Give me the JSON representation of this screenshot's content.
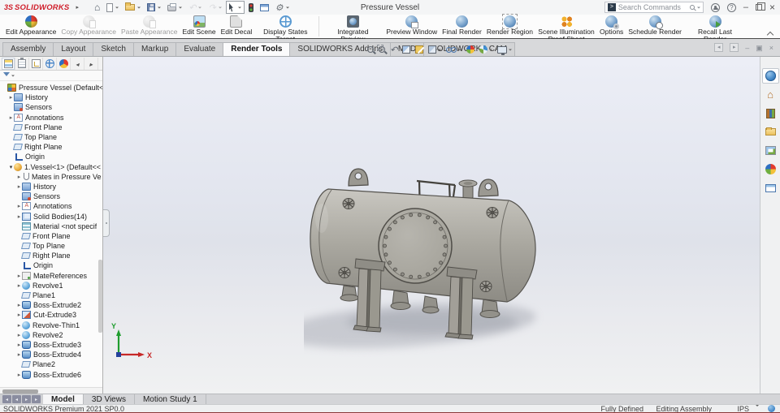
{
  "titlebar": {
    "logo_mark": "3S",
    "logo": "SOLIDWORKS",
    "title": "Pressure Vessel",
    "search_placeholder": "Search Commands"
  },
  "quick_toolbar": [
    {
      "name": "home-icon",
      "variant": "home",
      "caret": false
    },
    {
      "name": "new-document-icon",
      "variant": "new",
      "caret": true
    },
    {
      "name": "open-icon",
      "variant": "open",
      "caret": true
    },
    {
      "name": "save-icon",
      "variant": "save",
      "caret": true
    },
    {
      "name": "print-icon",
      "variant": "print",
      "caret": true
    },
    {
      "name": "undo-icon",
      "variant": "undo",
      "caret": true,
      "disabled": true
    },
    {
      "name": "redo-icon",
      "variant": "redo",
      "caret": true,
      "disabled": true
    },
    {
      "name": "select-cursor-icon",
      "variant": "select",
      "caret": true,
      "boxed": true
    },
    {
      "name": "traffic-light-icon",
      "variant": "traffic",
      "caret": false
    },
    {
      "name": "task-table-icon",
      "variant": "table",
      "caret": false
    },
    {
      "name": "settings-gear-icon",
      "variant": "gear",
      "caret": true
    }
  ],
  "ribbon": {
    "group1": [
      {
        "name": "edit-appearance-button",
        "label": "Edit Appearance",
        "variant": "edit-appearance"
      },
      {
        "name": "copy-appearance-button",
        "label": "Copy Appearance",
        "variant": "copy-appearance",
        "disabled": true
      },
      {
        "name": "paste-appearance-button",
        "label": "Paste Appearance",
        "variant": "paste-appearance",
        "disabled": true
      },
      {
        "name": "edit-scene-button",
        "label": "Edit Scene",
        "variant": "edit-scene"
      },
      {
        "name": "edit-decal-button",
        "label": "Edit Decal",
        "variant": "edit-decal"
      },
      {
        "name": "display-states-target-button",
        "label": "Display States Target",
        "variant": "display-states"
      }
    ],
    "group2": [
      {
        "name": "integrated-preview-button",
        "label": "Integrated Preview",
        "variant": "int-preview"
      },
      {
        "name": "preview-window-button",
        "label": "Preview Window",
        "variant": "prev-window"
      },
      {
        "name": "final-render-button",
        "label": "Final Render",
        "variant": "final-render"
      },
      {
        "name": "render-region-button",
        "label": "Render Region",
        "variant": "render-region"
      },
      {
        "name": "scene-illumination-proof-sheet-button",
        "label": "Scene Illumination Proof Sheet",
        "variant": "proof-sheet"
      },
      {
        "name": "options-button",
        "label": "Options",
        "variant": "options"
      },
      {
        "name": "schedule-render-button",
        "label": "Schedule Render",
        "variant": "schedule"
      },
      {
        "name": "recall-last-render-button",
        "label": "Recall Last Render",
        "variant": "recall"
      }
    ]
  },
  "command_tabs": [
    {
      "label": "Assembly"
    },
    {
      "label": "Layout"
    },
    {
      "label": "Sketch"
    },
    {
      "label": "Markup"
    },
    {
      "label": "Evaluate"
    },
    {
      "label": "Render Tools",
      "active": true
    },
    {
      "label": "SOLIDWORKS Add-Ins"
    },
    {
      "label": "MBD"
    },
    {
      "label": "SOLIDWORKS CAM"
    }
  ],
  "heads_up": [
    {
      "name": "zoom-to-fit-icon",
      "variant": "zoomfit",
      "caret": false
    },
    {
      "name": "zoom-to-area-icon",
      "variant": "zoomarea",
      "caret": false
    },
    {
      "name": "previous-view-icon",
      "variant": "prevview",
      "caret": false
    },
    {
      "name": "section-view-icon",
      "variant": "section",
      "caret": false
    },
    {
      "name": "dynamic-annotation-icon",
      "variant": "annotate",
      "caret": false
    },
    {
      "name": "display-style-icon",
      "variant": "dispstyle",
      "caret": true
    },
    {
      "name": "hide-show-items-icon",
      "variant": "hideshow",
      "caret": true
    },
    {
      "name": "edit-appearance-icon",
      "variant": "appearance",
      "caret": false
    },
    {
      "name": "apply-scene-icon",
      "variant": "scene",
      "caret": true
    },
    {
      "name": "view-settings-icon",
      "variant": "viewset",
      "caret": true
    }
  ],
  "doc_window_controls": [
    {
      "name": "doc-prev-icon",
      "glyph": "◂",
      "boxed": true
    },
    {
      "name": "doc-next-icon",
      "glyph": "▸",
      "boxed": true
    },
    {
      "name": "doc-minimize-icon",
      "glyph": "–",
      "boxed": false
    },
    {
      "name": "doc-restore-icon",
      "glyph": "▣",
      "boxed": false
    },
    {
      "name": "doc-close-icon",
      "glyph": "×",
      "boxed": false
    }
  ],
  "panel_tabs": [
    {
      "name": "featuremanager-tab",
      "variant": "featman",
      "active": true
    },
    {
      "name": "propertymanager-tab",
      "variant": "propman"
    },
    {
      "name": "configurationmanager-tab",
      "variant": "confman"
    },
    {
      "name": "dimxpertmanager-tab",
      "variant": "dimxpert"
    },
    {
      "name": "displaymanager-tab",
      "variant": "dispman"
    },
    {
      "name": "panel-tab-scroll-left",
      "variant": "arrowl"
    },
    {
      "name": "panel-tab-scroll-right",
      "variant": "arrowr"
    }
  ],
  "feature_tree": {
    "items": [
      {
        "label": "Pressure Vessel (Default<D",
        "icon": "asm",
        "arrow": "",
        "level": 0
      },
      {
        "label": "History",
        "icon": "folder",
        "arrow": "r",
        "level": 1
      },
      {
        "label": "Sensors",
        "icon": "sensors",
        "arrow": "",
        "level": 1
      },
      {
        "label": "Annotations",
        "icon": "annot",
        "arrow": "r",
        "level": 1
      },
      {
        "label": "Front Plane",
        "icon": "plane",
        "arrow": "",
        "level": 1
      },
      {
        "label": "Top Plane",
        "icon": "plane",
        "arrow": "",
        "level": 1
      },
      {
        "label": "Right Plane",
        "icon": "plane",
        "arrow": "",
        "level": 1
      },
      {
        "label": "Origin",
        "icon": "origin",
        "arrow": "",
        "level": 1
      },
      {
        "label": "1.Vessel<1> (Default<<",
        "icon": "part",
        "arrow": "d",
        "level": 1
      },
      {
        "label": "Mates in Pressure Ve",
        "icon": "mates",
        "arrow": "r",
        "level": 2
      },
      {
        "label": "History",
        "icon": "folder",
        "arrow": "r",
        "level": 2
      },
      {
        "label": "Sensors",
        "icon": "sensors",
        "arrow": "",
        "level": 2
      },
      {
        "label": "Annotations",
        "icon": "annot",
        "arrow": "r",
        "level": 2
      },
      {
        "label": "Solid Bodies(14)",
        "icon": "solid",
        "arrow": "r",
        "level": 2
      },
      {
        "label": "Material <not specif",
        "icon": "material",
        "arrow": "",
        "level": 2
      },
      {
        "label": "Front Plane",
        "icon": "plane",
        "arrow": "",
        "level": 2
      },
      {
        "label": "Top Plane",
        "icon": "plane",
        "arrow": "",
        "level": 2
      },
      {
        "label": "Right Plane",
        "icon": "plane",
        "arrow": "",
        "level": 2
      },
      {
        "label": "Origin",
        "icon": "origin",
        "arrow": "",
        "level": 2
      },
      {
        "label": "MateReferences",
        "icon": "materef",
        "arrow": "r",
        "level": 2
      },
      {
        "label": "Revolve1",
        "icon": "revolve",
        "arrow": "r",
        "level": 2
      },
      {
        "label": "Plane1",
        "icon": "plane",
        "arrow": "",
        "level": 2
      },
      {
        "label": "Boss-Extrude2",
        "icon": "extrude",
        "arrow": "r",
        "level": 2
      },
      {
        "label": "Cut-Extrude3",
        "icon": "cut",
        "arrow": "r",
        "level": 2
      },
      {
        "label": "Revolve-Thin1",
        "icon": "revolve",
        "arrow": "r",
        "level": 2
      },
      {
        "label": "Revolve2",
        "icon": "revolve",
        "arrow": "r",
        "level": 2
      },
      {
        "label": "Boss-Extrude3",
        "icon": "extrude",
        "arrow": "r",
        "level": 2
      },
      {
        "label": "Boss-Extrude4",
        "icon": "extrude",
        "arrow": "r",
        "level": 2
      },
      {
        "label": "Plane2",
        "icon": "plane",
        "arrow": "",
        "level": 2
      },
      {
        "label": "Boss-Extrude6",
        "icon": "extrude",
        "arrow": "r",
        "level": 2
      }
    ]
  },
  "viewport": {
    "triad": {
      "x_label": "X",
      "y_label": "Y"
    }
  },
  "task_pane": [
    {
      "name": "3dexperience-tab",
      "variant": "globe"
    },
    {
      "name": "solidworks-resources-tab",
      "variant": "home2"
    },
    {
      "name": "design-library-tab",
      "variant": "books"
    },
    {
      "name": "file-explorer-tab",
      "variant": "folder2"
    },
    {
      "name": "view-palette-tab",
      "variant": "palette"
    },
    {
      "name": "appearances-scenes-tab",
      "variant": "ball"
    },
    {
      "name": "custom-properties-tab",
      "variant": "proptable"
    }
  ],
  "bottom_nav": [
    {
      "name": "rewind-button",
      "glyph": "◂"
    },
    {
      "name": "prev-button",
      "glyph": "◂"
    },
    {
      "name": "next-button",
      "glyph": "▸"
    },
    {
      "name": "forward-button",
      "glyph": "▸"
    }
  ],
  "bottom_tabs": [
    {
      "label": "Model",
      "active": true
    },
    {
      "label": "3D Views"
    },
    {
      "label": "Motion Study 1"
    }
  ],
  "statusbar": {
    "product": "SOLIDWORKS Premium 2021 SP0.0",
    "defined": "Fully Defined",
    "mode": "Editing Assembly",
    "units": "IPS"
  }
}
